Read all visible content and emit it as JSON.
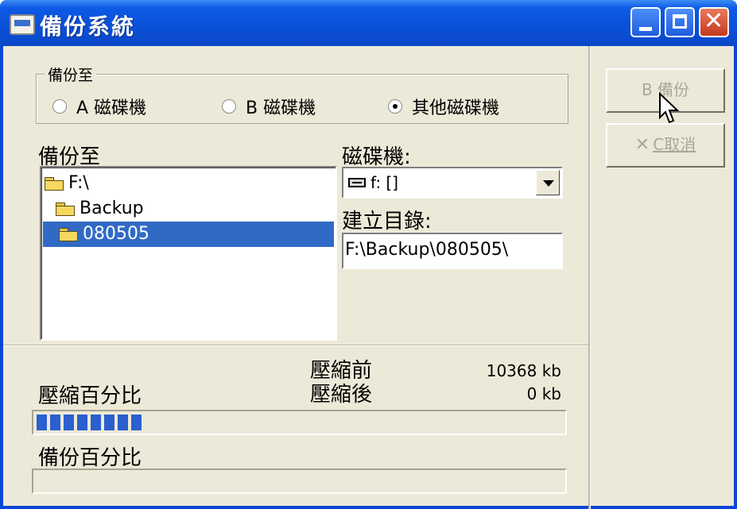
{
  "window": {
    "title": "備份系統",
    "accent_color": "#0a4fd8"
  },
  "groupbox": {
    "title": "備份至",
    "options": [
      {
        "label": "A 磁碟機",
        "checked": false
      },
      {
        "label": "B 磁碟機",
        "checked": false
      },
      {
        "label": "其他磁碟機",
        "checked": true
      }
    ]
  },
  "folders": {
    "label": "備份至",
    "items": [
      {
        "label": "F:\\",
        "selected": false
      },
      {
        "label": "Backup",
        "selected": false
      },
      {
        "label": "080505",
        "selected": true
      }
    ]
  },
  "drive": {
    "label": "磁碟機:",
    "value": "f: []"
  },
  "directory": {
    "label": "建立目錄:",
    "value": "F:\\Backup\\080505\\"
  },
  "buttons": {
    "backup_label": "B 備份",
    "cancel_label": "C取消"
  },
  "compression": {
    "before_label": "壓縮前",
    "after_label": "壓縮後",
    "before_value": "10368 kb",
    "after_value": "0 kb",
    "percent_label": "壓縮百分比",
    "progress_fraction": 0.2
  },
  "backup_progress": {
    "percent_label": "備份百分比",
    "progress_fraction": 0.0
  },
  "icons": {
    "app": "app-icon",
    "minimize": "minimize-icon",
    "maximize": "maximize-icon",
    "close": "close-icon",
    "folder": "folder-icon",
    "drive": "drive-icon",
    "cancel": "x-icon",
    "cursor": "mouse-cursor-icon"
  }
}
